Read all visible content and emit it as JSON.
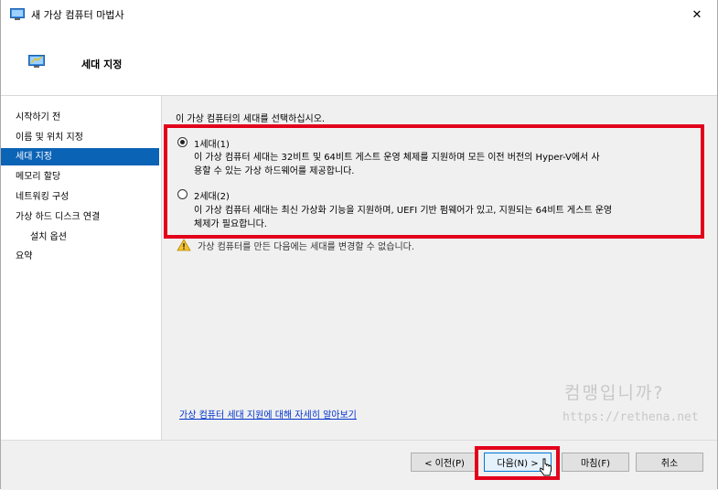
{
  "window": {
    "title": "새 가상 컴퓨터 마법사",
    "close_glyph": "✕"
  },
  "header": {
    "title": "세대 지정"
  },
  "sidebar": {
    "items": [
      {
        "label": "시작하기 전"
      },
      {
        "label": "이름 및 위치 지정"
      },
      {
        "label": "세대 지정"
      },
      {
        "label": "메모리 할당"
      },
      {
        "label": "네트워킹 구성"
      },
      {
        "label": "가상 하드 디스크 연결"
      },
      {
        "label": "설치 옵션"
      },
      {
        "label": "요약"
      }
    ],
    "active_index": 2
  },
  "content": {
    "instruction": "이 가상 컴퓨터의 세대를 선택하십시오.",
    "options": [
      {
        "label": "1세대(1)",
        "desc_line1": "이 가상 컴퓨터 세대는 32비트 및 64비트 게스트 운영 체제를 지원하며 모든 이전 버전의 Hyper-V에서 사",
        "desc_line2": "용할 수 있는 가상 하드웨어를 제공합니다.",
        "selected": true
      },
      {
        "label": "2세대(2)",
        "desc_line1": "이 가상 컴퓨터 세대는 최신 가상화 기능을 지원하며, UEFI 기반 펌웨어가 있고, 지원되는 64비트 게스트 운영",
        "desc_line2": "체제가 필요합니다.",
        "selected": false
      }
    ],
    "warning": "가상 컴퓨터를 만든 다음에는 세대를 변경할 수 없습니다.",
    "learn_more": "가상 컴퓨터 세대 지원에 대해 자세히 알아보기",
    "watermark_line1": "컴맹입니까?",
    "watermark_line2": "https://rethena.net"
  },
  "footer": {
    "prev_label": "< 이전(P)",
    "next_label": "다음(N) >",
    "finish_label": "마침(F)",
    "cancel_label": "취소"
  },
  "colors": {
    "accent": "#0b63b6",
    "highlight_red": "#e3001b",
    "link": "#0033cc"
  }
}
